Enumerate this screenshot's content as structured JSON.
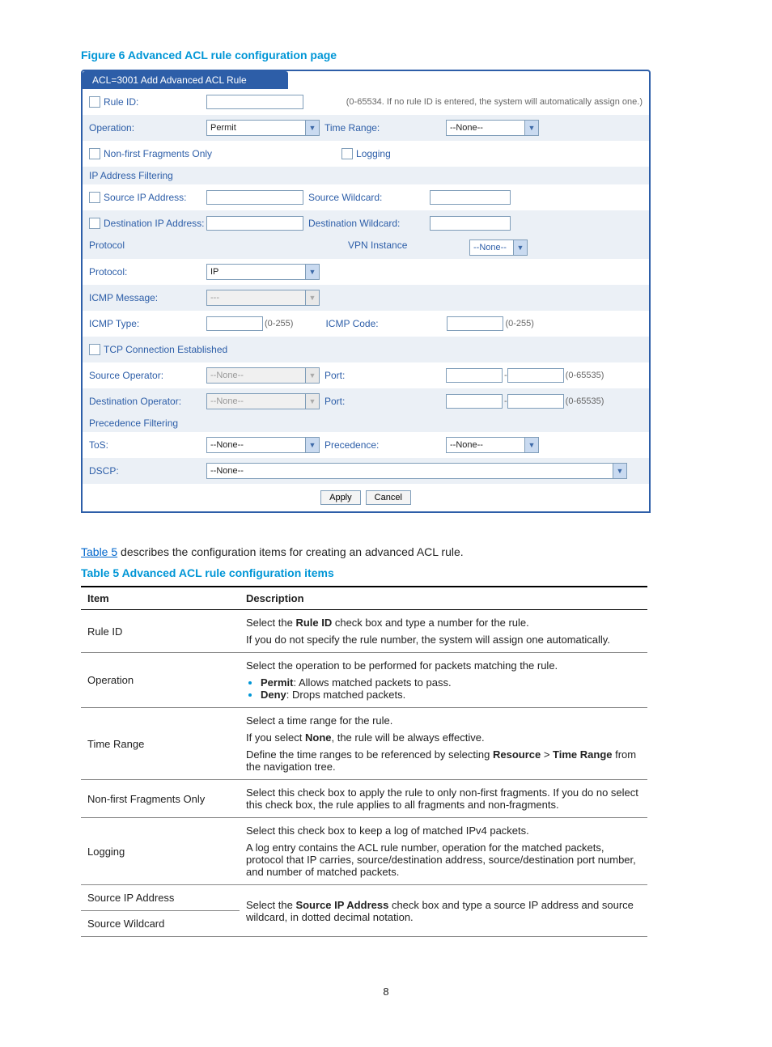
{
  "figure_caption": "Figure 6 Advanced ACL rule configuration page",
  "panel_title": "ACL=3001 Add Advanced ACL Rule",
  "form": {
    "rule_id_label": "Rule ID:",
    "rule_id_hint": "(0-65534. If no rule ID is entered, the system will automatically assign one.)",
    "operation_label": "Operation:",
    "operation_value": "Permit",
    "time_range_label": "Time Range:",
    "time_range_value": "--None--",
    "non_first_label": "Non-first Fragments Only",
    "logging_label": "Logging",
    "ip_filtering_header": "IP Address Filtering",
    "src_ip_label": "Source IP Address:",
    "src_wc_label": "Source Wildcard:",
    "dst_ip_label": "Destination IP Address:",
    "dst_wc_label": "Destination Wildcard:",
    "protocol_header": "Protocol",
    "vpn_instance_label": "VPN Instance",
    "vpn_instance_value": "--None--",
    "protocol_label": "Protocol:",
    "protocol_value": "IP",
    "icmp_msg_label": "ICMP Message:",
    "icmp_msg_value": "---",
    "icmp_type_label": "ICMP Type:",
    "icmp_hint": "(0-255)",
    "icmp_code_label": "ICMP Code:",
    "tcp_established_label": "TCP Connection Established",
    "src_op_label": "Source Operator:",
    "src_op_value": "--None--",
    "port_label_1": "Port:",
    "port_hint_1": "(0-65535)",
    "dst_op_label": "Destination Operator:",
    "dst_op_value": "--None--",
    "port_label_2": "Port:",
    "port_hint_2": "(0-65535)",
    "precedence_header": "Precedence Filtering",
    "tos_label": "ToS:",
    "tos_value": "--None--",
    "precedence_label": "Precedence:",
    "precedence_value": "--None--",
    "dscp_label": "DSCP:",
    "dscp_value": "--None--",
    "apply_btn": "Apply",
    "cancel_btn": "Cancel"
  },
  "body_link": "Table 5",
  "body_text_rest": " describes the configuration items for creating an advanced ACL rule.",
  "table_caption": "Table 5 Advanced ACL rule configuration items",
  "table_headers": {
    "item": "Item",
    "desc": "Description"
  },
  "table": {
    "rule_id_item": "Rule ID",
    "rule_id_l1": "Select the ",
    "rule_id_b1": "Rule ID",
    "rule_id_l1b": " check box and type a number for the rule.",
    "rule_id_l2": "If you do not specify the rule number, the system will assign one automatically.",
    "op_item": "Operation",
    "op_l1": "Select the operation to be performed for packets matching the rule.",
    "op_b1": "Permit",
    "op_b1t": ": Allows matched packets to pass.",
    "op_b2": "Deny",
    "op_b2t": ": Drops matched packets.",
    "tr_item": "Time Range",
    "tr_l1": "Select a time range for the rule.",
    "tr_l2a": "If you select ",
    "tr_l2b": "None",
    "tr_l2c": ", the rule will be always effective.",
    "tr_l3a": "Define the time ranges to be referenced by selecting ",
    "tr_l3b": "Resource",
    "tr_l3c": " > ",
    "tr_l3d": "Time Range",
    "tr_l3e": " from the navigation tree.",
    "nf_item": "Non-first Fragments Only",
    "nf_l1": "Select this check box to apply the rule to only non-first fragments. If you do no select this check box, the rule applies to all fragments and non-fragments.",
    "log_item": "Logging",
    "log_l1": "Select this check box to keep a log of matched IPv4 packets.",
    "log_l2": "A log entry contains the ACL rule number, operation for the matched packets, protocol that IP carries, source/destination address, source/destination port number, and number of matched packets.",
    "sip_item": "Source IP Address",
    "swc_item": "Source Wildcard",
    "sip_desc_a": "Select the ",
    "sip_desc_b": "Source IP Address",
    "sip_desc_c": " check box and type a source IP address and source wildcard, in dotted decimal notation."
  },
  "page_number": "8"
}
